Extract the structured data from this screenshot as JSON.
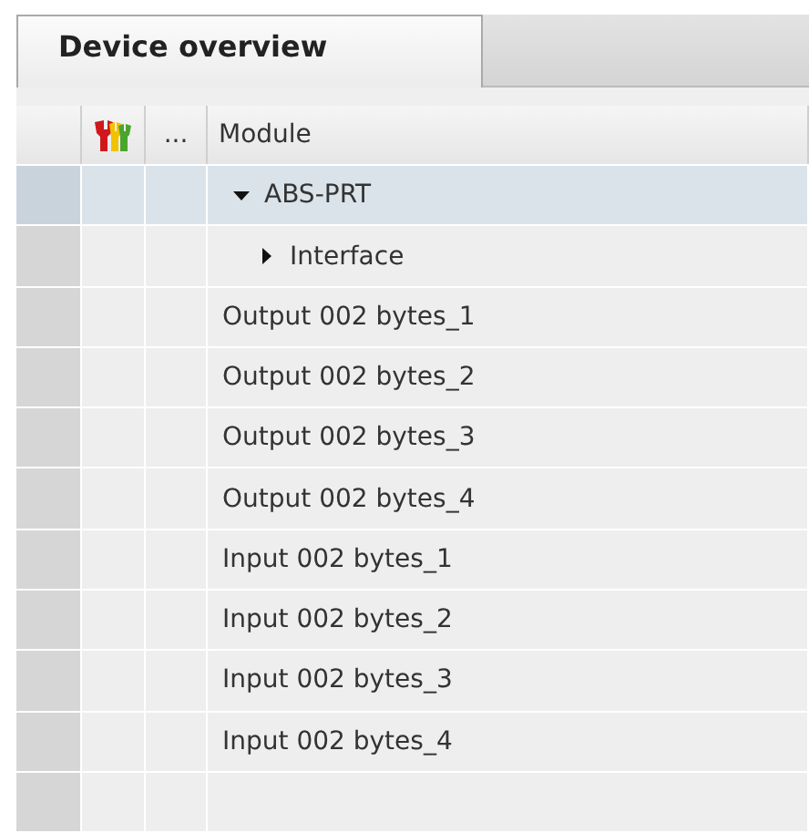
{
  "tab": {
    "label": "Device overview",
    "selected": true
  },
  "table": {
    "columns": [
      "...",
      "Module"
    ],
    "rows": [
      {
        "module": "ABS-PRT",
        "expanded": true,
        "selected": true,
        "children": [
          {
            "module": "Interface",
            "expanded": false,
            "selected": false
          }
        ]
      },
      {
        "module": "Output 002 bytes_1",
        "selected": false
      },
      {
        "module": "Output 002 bytes_2",
        "selected": false
      },
      {
        "module": "Output 002 bytes_3",
        "selected": false
      },
      {
        "module": "Output 002 bytes_4",
        "selected": false
      },
      {
        "module": "Input 002 bytes_1",
        "selected": false
      },
      {
        "module": "Input 002 bytes_2",
        "selected": false
      },
      {
        "module": "Input 002 bytes_3",
        "selected": false
      },
      {
        "module": "Input 002 bytes_4",
        "selected": false
      }
    ]
  }
}
